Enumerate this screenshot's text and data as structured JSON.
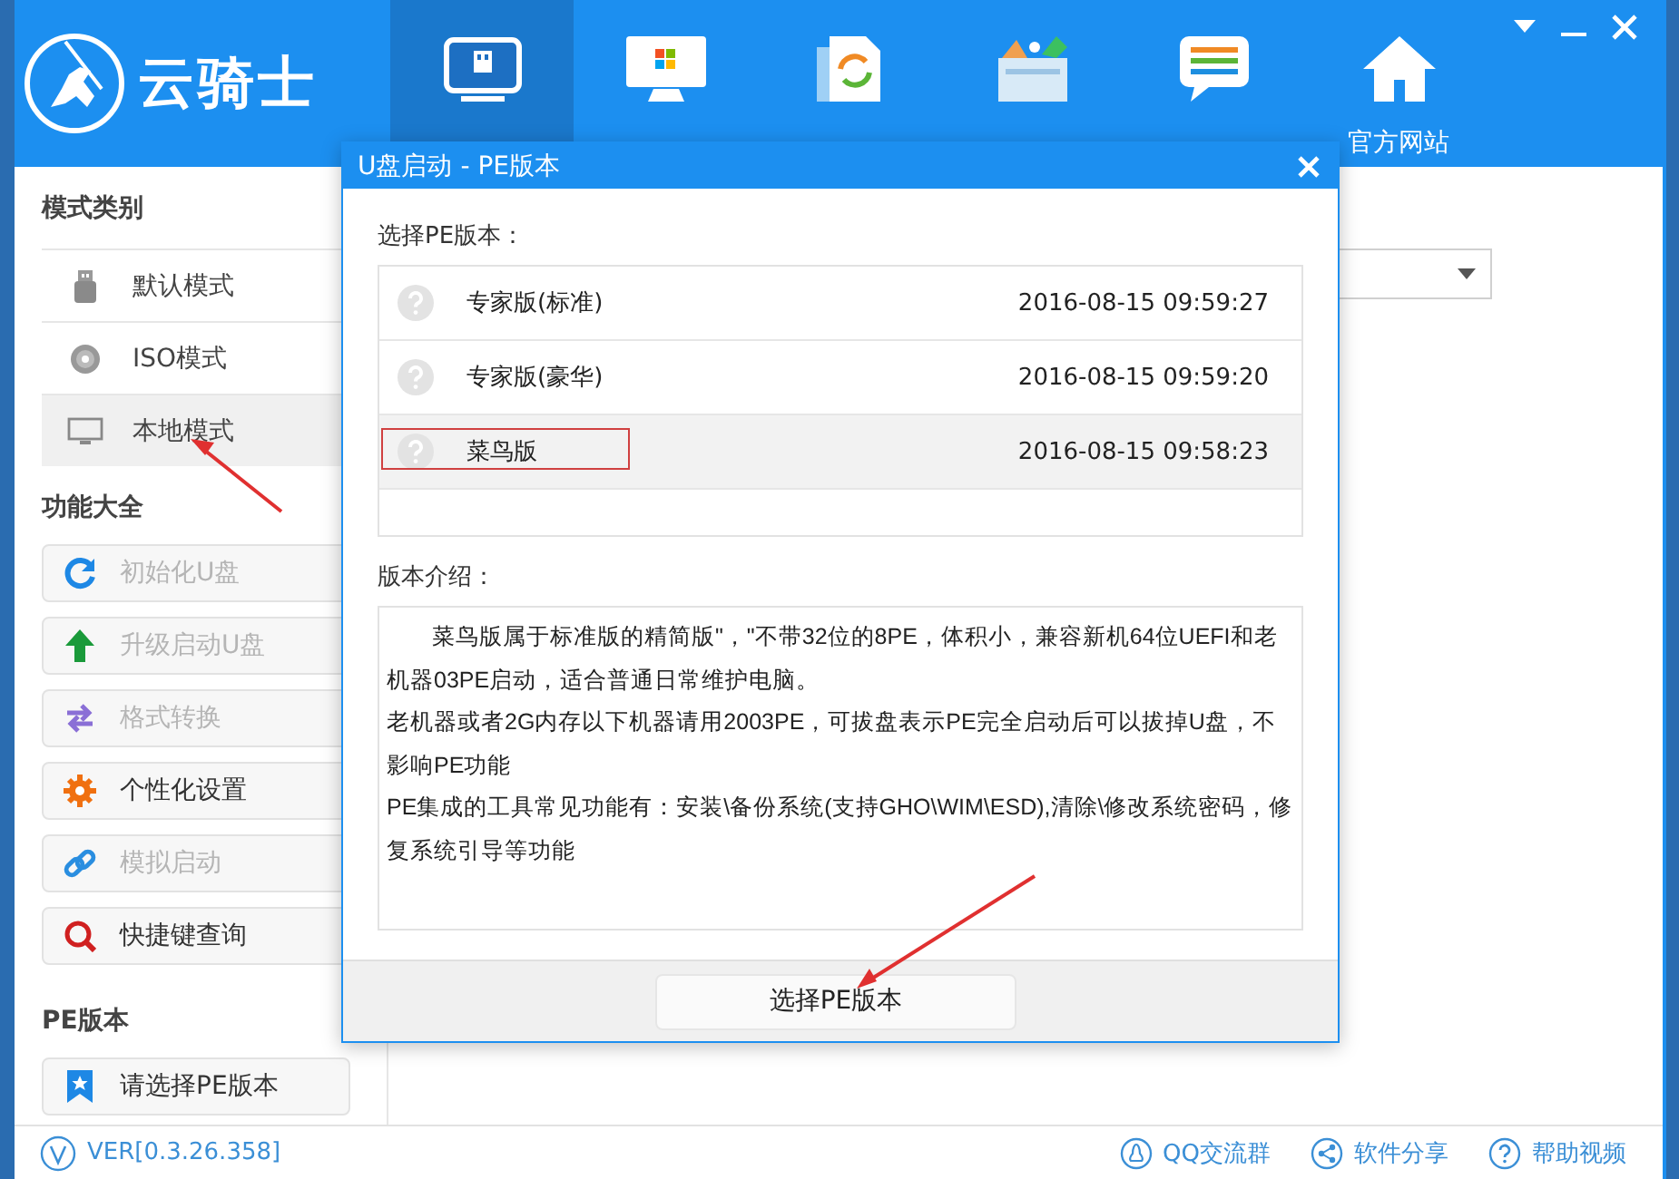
{
  "app": {
    "logo_text": "云骑士"
  },
  "nav": [
    {
      "selected": true
    },
    {
      "selected": false
    },
    {
      "selected": false
    },
    {
      "selected": false
    },
    {
      "selected": false
    },
    {
      "label": "官方网站",
      "selected": false
    }
  ],
  "sidebar": {
    "sections": [
      {
        "title": "模式类别",
        "items": [
          {
            "kind": "mode",
            "label": "默认模式",
            "selected": false
          },
          {
            "kind": "mode",
            "label": "ISO模式",
            "selected": false
          },
          {
            "kind": "mode",
            "label": "本地模式",
            "selected": true
          }
        ]
      },
      {
        "title": "功能大全",
        "items": [
          {
            "kind": "action",
            "label": "初始化U盘",
            "disabled": true
          },
          {
            "kind": "action",
            "label": "升级启动U盘",
            "disabled": true
          },
          {
            "kind": "action",
            "label": "格式转换",
            "disabled": true
          },
          {
            "kind": "action",
            "label": "个性化设置",
            "disabled": false
          },
          {
            "kind": "action",
            "label": "模拟启动",
            "disabled": true
          },
          {
            "kind": "action",
            "label": "快捷键查询",
            "disabled": false
          }
        ]
      },
      {
        "title": "PE版本",
        "items": [
          {
            "kind": "action",
            "label": "请选择PE版本",
            "disabled": false
          }
        ]
      }
    ]
  },
  "footer": {
    "version": "VER[0.3.26.358]",
    "links": [
      {
        "label": "QQ交流群"
      },
      {
        "label": "软件分享"
      },
      {
        "label": "帮助视频"
      }
    ]
  },
  "dialog": {
    "title": "U盘启动 - PE版本",
    "list_label": "选择PE版本：",
    "versions": [
      {
        "name": "专家版(标准)",
        "date": "2016-08-15 09:59:27",
        "selected": false
      },
      {
        "name": "专家版(豪华)",
        "date": "2016-08-15 09:59:20",
        "selected": false
      },
      {
        "name": "菜鸟版",
        "date": "2016-08-15 09:58:23",
        "selected": true
      }
    ],
    "intro_label": "版本介绍：",
    "intro": [
      "菜鸟版属于标准版的精简版\"，\"不带32位的8PE，体积小，兼容新机64位UEFI和老机器03PE启动，适合普通日常维护电脑。",
      "老机器或者2G内存以下机器请用2003PE，可拔盘表示PE完全启动后可以拔掉U盘，不影响PE功能",
      "PE集成的工具常见功能有：安装\\备份系统(支持GHO\\WIM\\ESD),清除\\修改系统密码，修复系统引导等功能"
    ],
    "button": "选择PE版本"
  }
}
